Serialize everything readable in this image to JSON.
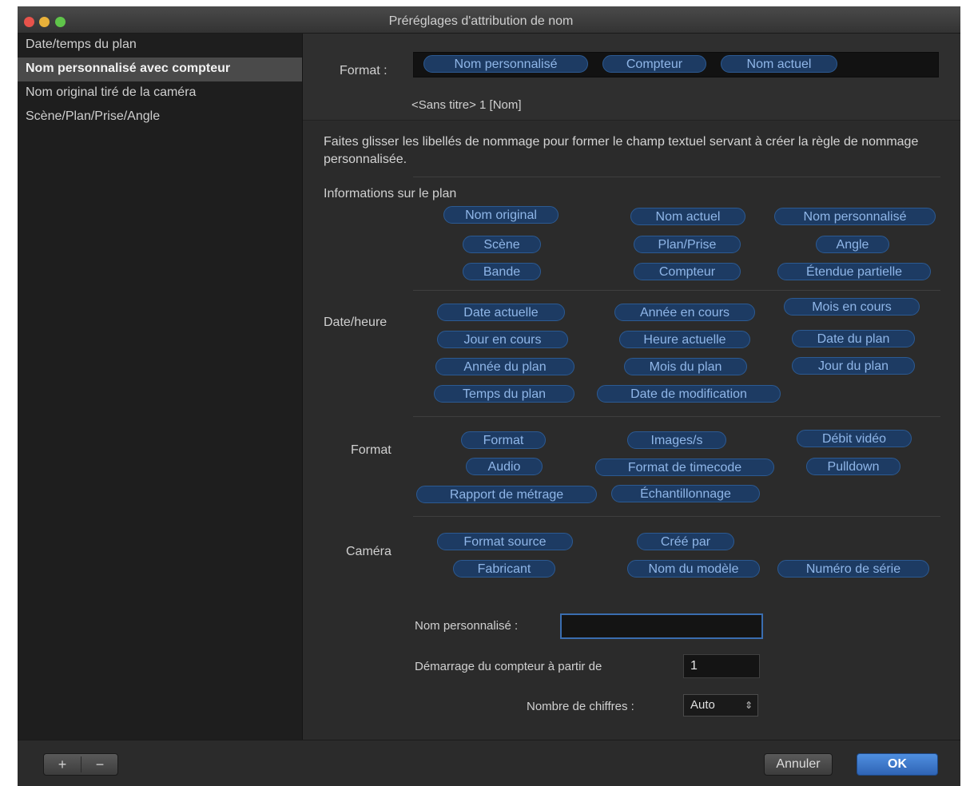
{
  "window": {
    "title": "Préréglages d'attribution de nom"
  },
  "sidebar": {
    "items": [
      {
        "label": "Date/temps du plan",
        "selected": false
      },
      {
        "label": "Nom personnalisé avec compteur",
        "selected": true
      },
      {
        "label": "Nom original tiré de la caméra",
        "selected": false
      },
      {
        "label": "Scène/Plan/Prise/Angle",
        "selected": false
      }
    ]
  },
  "format": {
    "label": "Format :",
    "tokens": [
      "Nom personnalisé",
      "Compteur",
      "Nom actuel"
    ],
    "preview": "<Sans titre> 1 [Nom]"
  },
  "description": "Faites glisser les libellés de nommage pour former le champ textuel servant à créer la règle de nommage personnalisée.",
  "sections": {
    "info": {
      "label": "Informations sur le plan",
      "tokens": [
        "Nom original",
        "Nom actuel",
        "Nom personnalisé",
        "Scène",
        "Plan/Prise",
        "Angle",
        "Bande",
        "Compteur",
        "Étendue partielle"
      ]
    },
    "date": {
      "label": "Date/heure",
      "tokens": [
        "Date actuelle",
        "Année en cours",
        "Mois en cours",
        "Jour en cours",
        "Heure actuelle",
        "Date du plan",
        "Année du plan",
        "Mois du plan",
        "Jour du plan",
        "Temps du plan",
        "Date de modification"
      ]
    },
    "format": {
      "label": "Format",
      "tokens": [
        "Format",
        "Images/s",
        "Débit vidéo",
        "Audio",
        "Format de timecode",
        "Pulldown",
        "Rapport de métrage",
        "Échantillonnage"
      ]
    },
    "camera": {
      "label": "Caméra",
      "tokens": [
        "Format source",
        "Créé par",
        "Fabricant",
        "Nom du modèle",
        "Numéro de série"
      ]
    }
  },
  "fields": {
    "custom_name_label": "Nom personnalisé :",
    "custom_name_value": "",
    "counter_start_label": "Démarrage du compteur à partir de",
    "counter_start_value": "1",
    "digits_label": "Nombre de chiffres :",
    "digits_value": "Auto"
  },
  "footer": {
    "add_label": "+",
    "remove_label": "−",
    "cancel_label": "Annuler",
    "ok_label": "OK"
  },
  "colors": {
    "token_fill": "#1d3b63",
    "token_border": "#2c5a92",
    "token_text": "#8fb6e8",
    "accent": "#3a6db0"
  }
}
